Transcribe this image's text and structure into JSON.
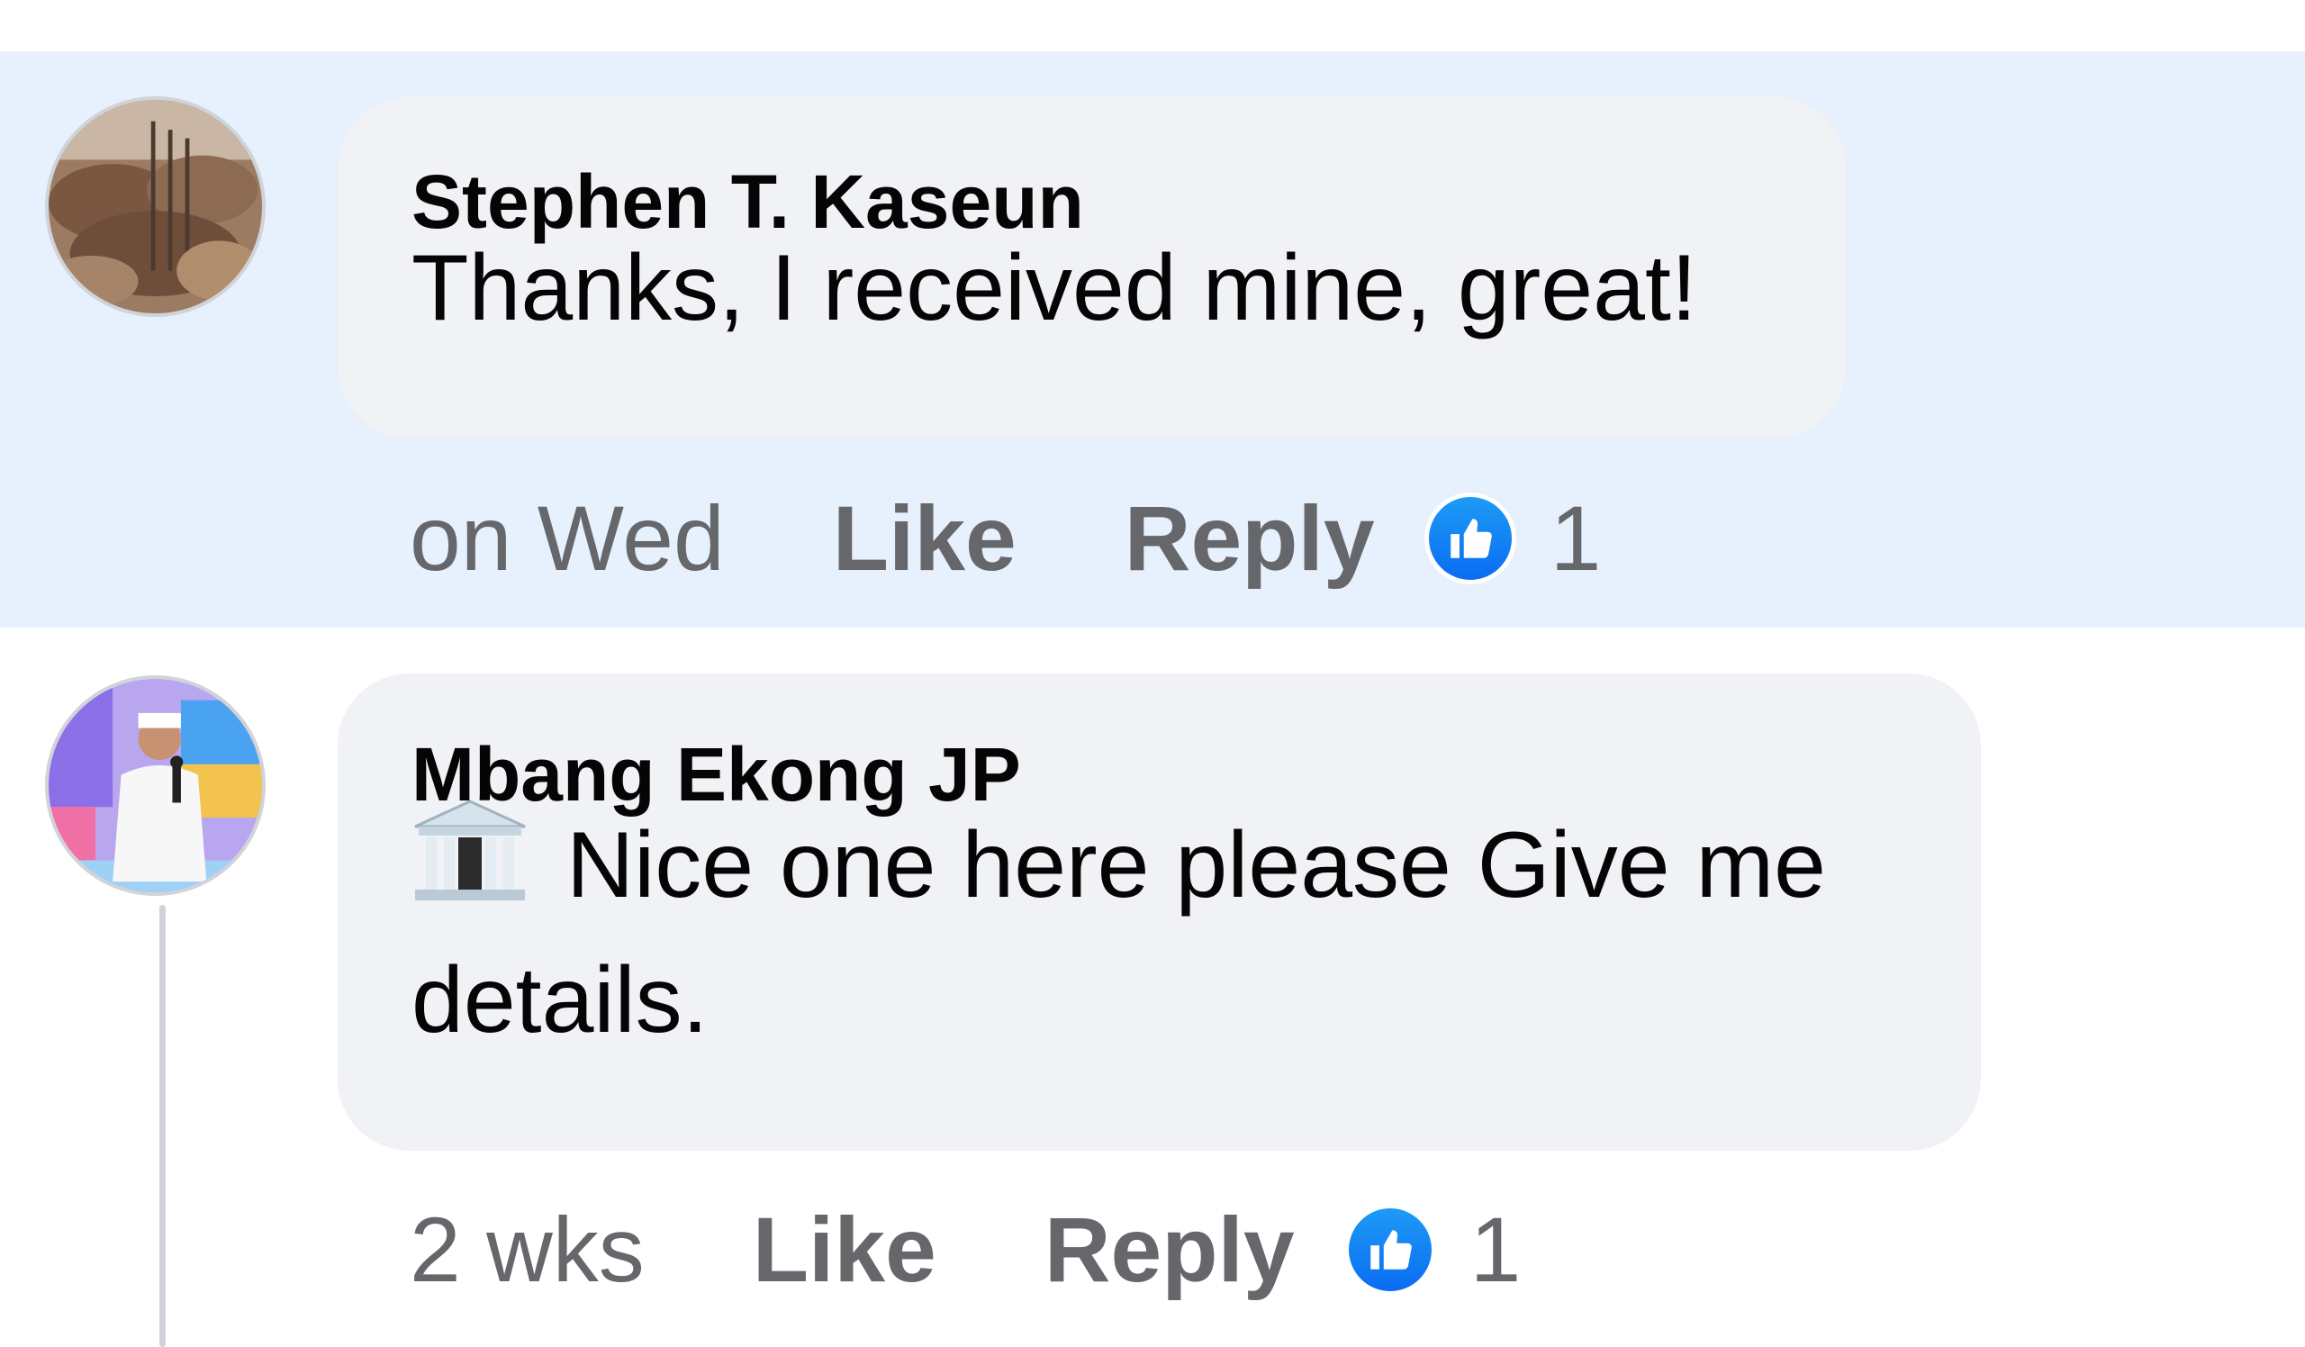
{
  "comments": [
    {
      "author": "Stephen T. Kaseun",
      "avatar_icon": "landscape-rocks-avatar",
      "text": "Thanks, I received mine, great!",
      "time": "on Wed",
      "like_label": "Like",
      "reply_label": "Reply",
      "reaction_icon": "thumbs-up-icon",
      "reaction_count": "1",
      "highlighted": true
    },
    {
      "author": "Mbang Ekong JP",
      "avatar_icon": "person-with-microphone-avatar",
      "text_icon": "classical-building-icon",
      "text_line1": "Nice one here please Give me",
      "text_line2": "details.",
      "time": "2 wks",
      "like_label": "Like",
      "reply_label": "Reply",
      "reaction_icon": "thumbs-up-icon",
      "reaction_count": "1",
      "highlighted": false
    }
  ],
  "colors": {
    "highlight": "#e7f0fd",
    "bubble": "#f0f2f5",
    "meta_text": "#65676b",
    "like_blue": "#0a6cf2"
  }
}
